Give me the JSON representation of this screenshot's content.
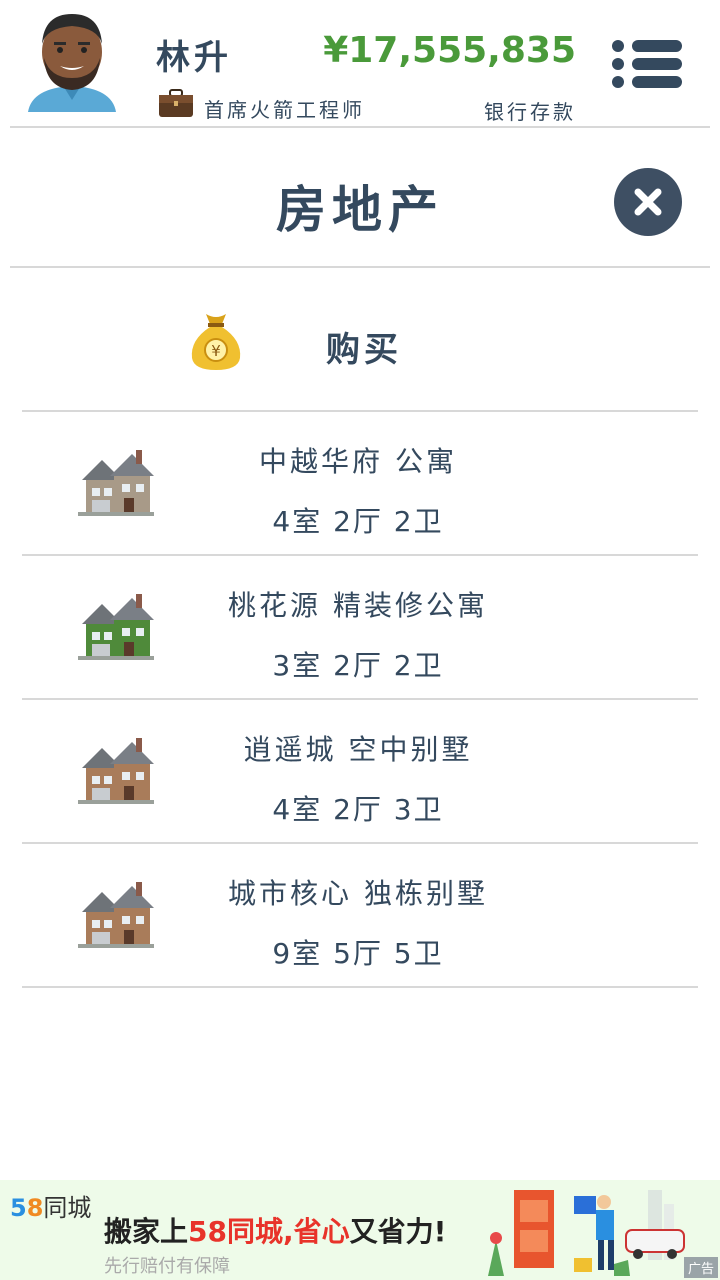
{
  "header": {
    "player_name": "林升",
    "job_title": "首席火箭工程师",
    "money": "¥17,555,835",
    "money_label": "银行存款"
  },
  "page": {
    "title": "房地产"
  },
  "buy": {
    "label": "购买"
  },
  "properties": [
    {
      "name": "中越华府 公寓",
      "rooms": "4室 2厅 2卫",
      "house_color": "#a89a88"
    },
    {
      "name": "桃花源 精装修公寓",
      "rooms": "3室 2厅 2卫",
      "house_color": "#4f8a3a"
    },
    {
      "name": "逍遥城 空中别墅",
      "rooms": "4室 2厅 3卫",
      "house_color": "#a97c5a"
    },
    {
      "name": "城市核心 独栋别墅",
      "rooms": "9室 5厅 5卫",
      "house_color": "#a97c5a"
    }
  ],
  "ad": {
    "logo_5": "5",
    "logo_8": "8",
    "logo_text": "同城",
    "main_pre": "搬家上",
    "main_hl": "58同城,省心",
    "main_post": "又省力!",
    "sub": "先行赔付有保障",
    "tag": "广告"
  },
  "colors": {
    "primary": "#34495e",
    "money": "#4a9a3a",
    "ad_bg": "#eefbe9"
  }
}
